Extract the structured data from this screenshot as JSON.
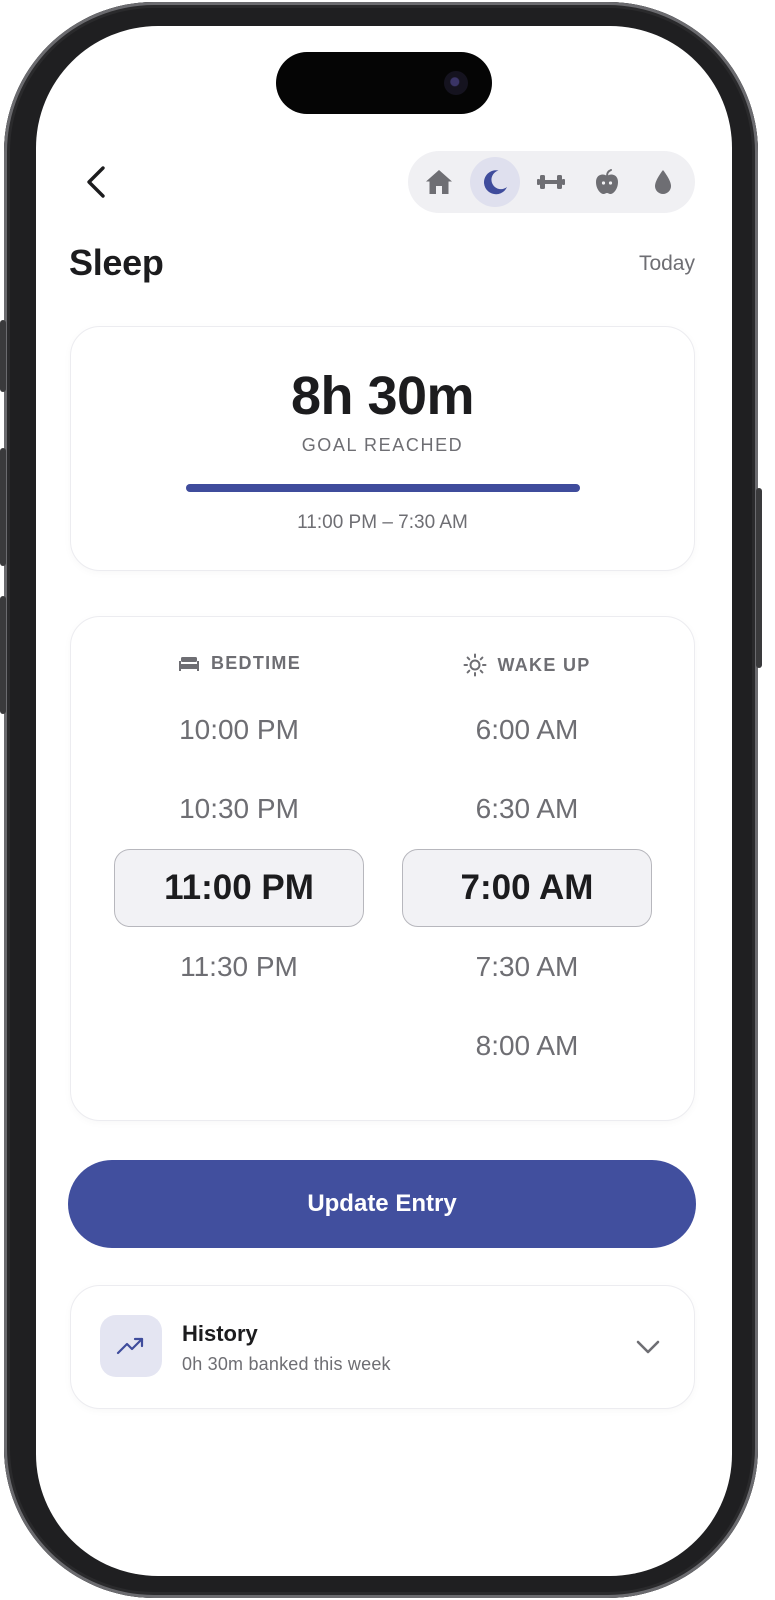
{
  "header": {
    "title": "Sleep",
    "date_label": "Today",
    "tabs": [
      {
        "icon": "home-icon",
        "active": false
      },
      {
        "icon": "moon-icon",
        "active": true
      },
      {
        "icon": "dumbbell-icon",
        "active": false
      },
      {
        "icon": "apple-icon",
        "active": false
      },
      {
        "icon": "water-drop-icon",
        "active": false
      }
    ]
  },
  "summary": {
    "duration": "8h 30m",
    "status": "GOAL REACHED",
    "range": "11:00 PM – 7:30 AM",
    "progress": 1.0
  },
  "picker": {
    "bedtime": {
      "label": "BEDTIME",
      "options": [
        "10:00 PM",
        "10:30 PM",
        "11:00 PM",
        "11:30 PM"
      ],
      "selected": "11:00 PM"
    },
    "wakeup": {
      "label": "WAKE UP",
      "options": [
        "6:00 AM",
        "6:30 AM",
        "7:00 AM",
        "7:30 AM",
        "8:00 AM"
      ],
      "selected": "7:00 AM"
    }
  },
  "actions": {
    "update_label": "Update Entry"
  },
  "history": {
    "title": "History",
    "subtitle": "0h 30m banked this week"
  },
  "colors": {
    "accent": "#414f9e",
    "active_tab_bg": "#dfe0ee",
    "text_primary": "#1c1c1e",
    "text_secondary": "#6e6e73"
  }
}
